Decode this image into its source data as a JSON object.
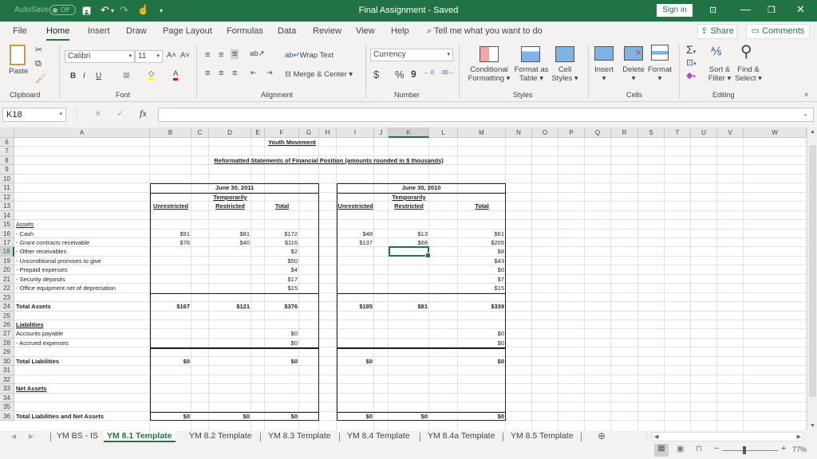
{
  "titlebar": {
    "autosave_label": "AutoSave",
    "autosave_state": "Off",
    "title": "Final Assignment  -  Saved",
    "sign_in": "Sign in"
  },
  "menu": {
    "items": [
      "File",
      "Home",
      "Insert",
      "Draw",
      "Page Layout",
      "Formulas",
      "Data",
      "Review",
      "View",
      "Help"
    ],
    "active": "Home",
    "tell_me": "Tell me what you want to do",
    "share": "Share",
    "comments": "Comments"
  },
  "ribbon": {
    "clipboard": {
      "paste": "Paste",
      "label": "Clipboard"
    },
    "font": {
      "name": "Calibri",
      "size": "11",
      "label": "Font",
      "bold": "B",
      "italic": "I",
      "underline": "U"
    },
    "alignment": {
      "wrap_text": "Wrap Text",
      "merge_center": "Merge & Center",
      "label": "Alignment"
    },
    "number": {
      "format": "Currency",
      "label": "Number",
      "dollar": "$",
      "percent": "%",
      "comma": "9"
    },
    "styles": {
      "conditional": "Conditional",
      "conditional2": "Formatting",
      "format_as": "Format as",
      "format_as2": "Table",
      "cell": "Cell",
      "cell2": "Styles",
      "label": "Styles"
    },
    "cells": {
      "insert": "Insert",
      "delete": "Delete",
      "format": "Format",
      "label": "Cells"
    },
    "editing": {
      "sort": "Sort &",
      "sort2": "Filter",
      "find": "Find &",
      "find2": "Select",
      "label": "Editing"
    }
  },
  "formula_bar": {
    "name_box": "K18",
    "formula": ""
  },
  "columns": [
    "A",
    "B",
    "C",
    "D",
    "E",
    "F",
    "G",
    "H",
    "I",
    "J",
    "K",
    "L",
    "M",
    "N",
    "O",
    "P",
    "Q",
    "R",
    "S",
    "T",
    "U",
    "V",
    "W"
  ],
  "selected_cell": {
    "column": "K",
    "row": 18
  },
  "rows": [
    6,
    7,
    8,
    9,
    10,
    11,
    12,
    13,
    14,
    15,
    16,
    17,
    18,
    19,
    20,
    21,
    22,
    23,
    24,
    25,
    26,
    27,
    28,
    29,
    30,
    31,
    32,
    33,
    34,
    35,
    36
  ],
  "sheet": {
    "title": "Youth Movement",
    "subtitle": "Reformatted Statements of Financial Position (amounts rounded in $ thousands)",
    "period1": {
      "date": "June 30, 2011",
      "temp1": "Temporarily",
      "temp2": "Restricted",
      "unrestricted": "Unrestricted",
      "total": "Total"
    },
    "period2": {
      "date": "June 30, 2010",
      "temp1": "Temporarily",
      "temp2": "Restricted",
      "unrestricted": "Unrestricted",
      "total": "Total"
    },
    "lines": [
      {
        "row": 15,
        "label": "Assets",
        "style": "underline"
      },
      {
        "row": 16,
        "label": " - Cash",
        "u1": "$91",
        "r1": "$81",
        "t1": "$172",
        "u2": "$48",
        "r2": "$13",
        "t2": "$61"
      },
      {
        "row": 17,
        "label": " - Grant contracts receivable",
        "u1": "$76",
        "r1": "$40",
        "t1": "$116",
        "u2": "$137",
        "r2": "$68",
        "t2": "$205"
      },
      {
        "row": 18,
        "label": " - Other receivables",
        "t1": "$2",
        "t2": "$8"
      },
      {
        "row": 19,
        "label": " - Unconditional promises to give",
        "t1": "$50",
        "t2": "$43"
      },
      {
        "row": 20,
        "label": " - Prepaid expenses",
        "t1": "$4",
        "t2": "$0"
      },
      {
        "row": 21,
        "label": " - Security deposits",
        "t1": "$17",
        "t2": "$7"
      },
      {
        "row": 22,
        "label": " - Office equipment net of depreciation",
        "t1": "$15",
        "t2": "$15"
      },
      {
        "row": 24,
        "label": "Total Assets",
        "style": "bold",
        "u1": "$167",
        "r1": "$121",
        "t1": "$376",
        "u2": "$185",
        "r2": "$81",
        "t2": "$339"
      },
      {
        "row": 26,
        "label": "Liabilities",
        "style": "bold-underline"
      },
      {
        "row": 27,
        "label": "   Accounts payable",
        "t1": "$0",
        "t2": "$0"
      },
      {
        "row": 28,
        "label": " - Accrued expenses",
        "t1": "$0",
        "t2": "$0"
      },
      {
        "row": 30,
        "label": "Total Liabilities",
        "style": "bold",
        "u1": "$0",
        "t1": "$0",
        "u2": "$0",
        "t2": "$0"
      },
      {
        "row": 33,
        "label": "Net Assets",
        "style": "bold-underline"
      },
      {
        "row": 36,
        "label": "Total Liabilities and Net Assets",
        "style": "bold",
        "u1": "$0",
        "r1": "$0",
        "t1": "$0",
        "u2": "$0",
        "r2": "$0",
        "t2": "$0"
      }
    ]
  },
  "sheet_tabs": [
    "YM BS - IS",
    "YM 8.1 Template",
    "YM 8.2 Template",
    "YM 8.3 Template",
    "YM 8.4 Template",
    "YM 8.4a Template",
    "YM 8.5 Template"
  ],
  "active_tab": "YM 8.1 Template",
  "status": {
    "zoom": "77%"
  }
}
